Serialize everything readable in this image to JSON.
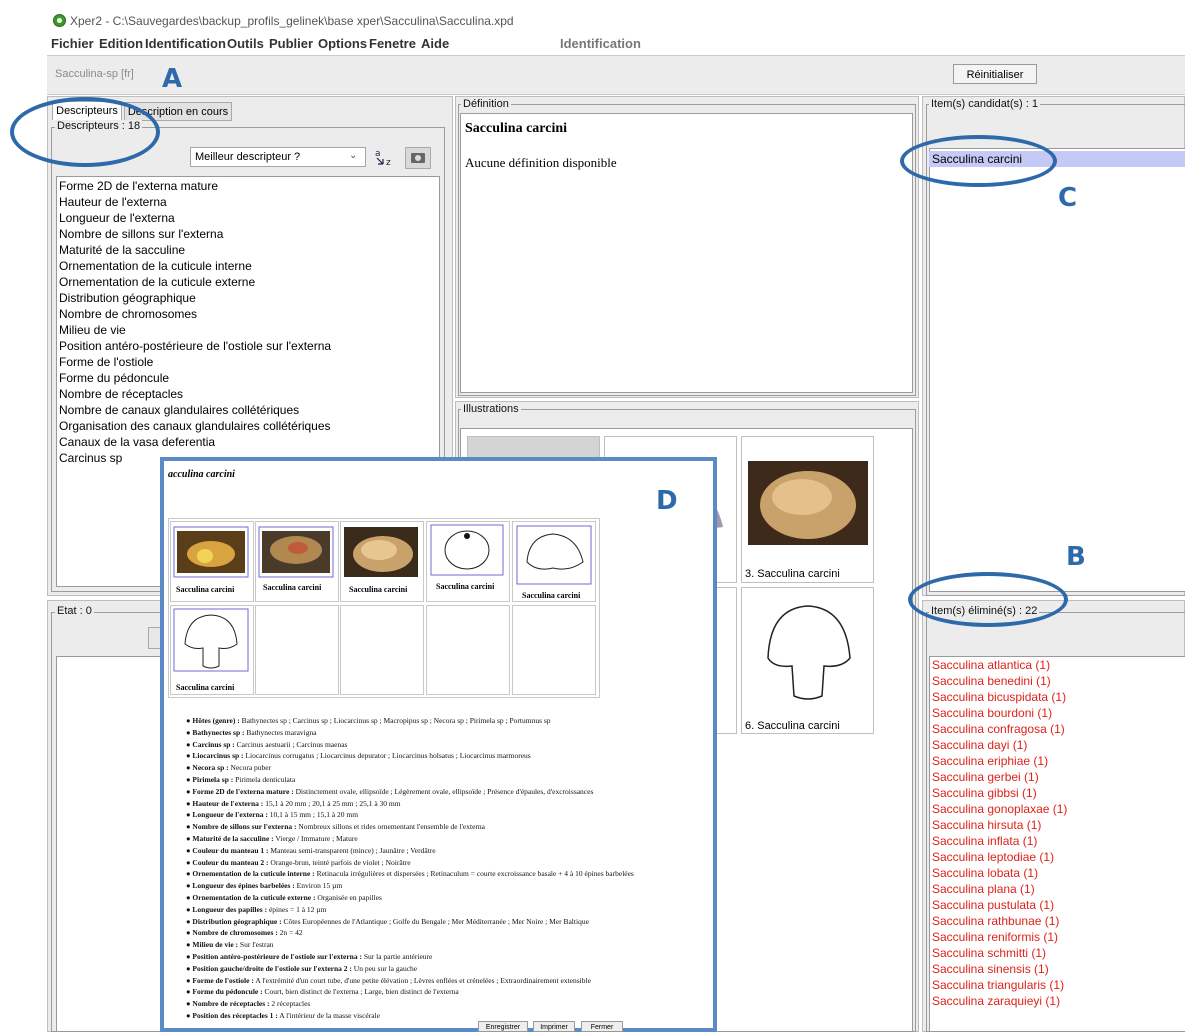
{
  "window": {
    "title": "Xper2 - C:\\Sauvegardes\\backup_profils_gelinek\\base xper\\Sacculina\\Sacculina.xpd"
  },
  "menu": {
    "items": [
      "Fichier",
      "Edition",
      "Identification",
      "Outils",
      "Publier",
      "Options",
      "Fenetre",
      "Aide"
    ],
    "mode": "Identification"
  },
  "toolbar": {
    "item_name": "Sacculina-sp [fr]",
    "reset_label": "Réinitialiser"
  },
  "descriptors_panel": {
    "tabs": [
      "Descripteurs",
      "Description en cours"
    ],
    "legend": "Descripteurs : 18",
    "dropdown_value": "Meilleur descripteur ?",
    "items": [
      "Forme 2D de l'externa mature",
      "Hauteur de l'externa",
      "Longueur de l'externa",
      "Nombre de sillons sur l'externa",
      "Maturité de la sacculine",
      "Ornementation de la cuticule interne",
      "Ornementation de la cuticule externe",
      "Distribution géographique",
      "Nombre de chromosomes",
      "Milieu de vie",
      "Position antéro-postérieure de l'ostiole sur l'externa",
      "Forme de l'ostiole",
      "Forme du pédoncule",
      "Nombre de réceptacles",
      "Nombre de canaux glandulaires collétériques",
      "Organisation des canaux glandulaires collétériques",
      "Canaux de la vasa deferentia",
      "Carcinus sp"
    ]
  },
  "state_panel": {
    "legend": "Etat : 0"
  },
  "definition_panel": {
    "legend": "Définition",
    "title": "Sacculina carcini",
    "text": "Aucune définition disponible"
  },
  "illustrations_panel": {
    "legend": "Illustrations",
    "captions": [
      "3. Sacculina carcini",
      "6. Sacculina carcini"
    ]
  },
  "candidates_panel": {
    "legend": "Item(s) candidat(s) : 1",
    "items": [
      "Sacculina carcini"
    ]
  },
  "eliminated_panel": {
    "legend": "Item(s) éliminé(s) : 22",
    "items": [
      "Sacculina atlantica (1)",
      "Sacculina benedini (1)",
      "Sacculina bicuspidata (1)",
      "Sacculina bourdoni (1)",
      "Sacculina confragosa (1)",
      "Sacculina dayi (1)",
      "Sacculina eriphiae (1)",
      "Sacculina gerbei (1)",
      "Sacculina gibbsi (1)",
      "Sacculina gonoplaxae (1)",
      "Sacculina hirsuta (1)",
      "Sacculina inflata (1)",
      "Sacculina leptodiae (1)",
      "Sacculina lobata (1)",
      "Sacculina plana (1)",
      "Sacculina pustulata (1)",
      "Sacculina rathbunae (1)",
      "Sacculina reniformis (1)",
      "Sacculina schmitti (1)",
      "Sacculina sinensis (1)",
      "Sacculina triangularis (1)",
      "Sacculina zaraquieyi (1)"
    ]
  },
  "annotations": {
    "a": "A",
    "b": "B",
    "c": "C",
    "d": "D"
  },
  "popup": {
    "title": "acculina carcini",
    "thumb_captions": [
      "Sacculina carcini",
      "Sacculina carcini",
      "Sacculina carcini",
      "Sacculina carcini",
      "Sacculina carcini",
      "Sacculina carcini"
    ],
    "facts": [
      {
        "label": "Hôtes (genre) :",
        "value": "Bathynectes sp ; Carcinus sp ; Liocarcinus sp ; Macropipus sp ; Necora sp ; Pirimela sp ; Portumnus sp"
      },
      {
        "label": "Bathynectes sp :",
        "value": "Bathynectes maravigna"
      },
      {
        "label": "Carcinus sp :",
        "value": "Carcinus aestuarii ; Carcinus maenas"
      },
      {
        "label": "Liocarcinus sp :",
        "value": "Liocarcinus corrugatus ; Liocarcinus depurator ; Liocarcinus holsatus ; Liocarcinus marmoreus"
      },
      {
        "label": "Necora sp :",
        "value": "Necora puber"
      },
      {
        "label": "Pirimela sp :",
        "value": "Pirimela denticulata"
      },
      {
        "label": "Forme 2D de l'externa mature :",
        "value": "Distinctement ovale, ellipsoïde ; Légèrement ovale, ellipsoïde ; Présence d'épaules, d'excroissances"
      },
      {
        "label": "Hauteur de l'externa :",
        "value": "15,1 à 20 mm ; 20,1 à 25 mm ; 25,1 à 30 mm"
      },
      {
        "label": "Longueur de l'externa :",
        "value": "10,1 à 15 mm ; 15,1 à 20 mm"
      },
      {
        "label": "Nombre de sillons sur l'externa :",
        "value": "Nombreux sillons et rides ornementant l'ensemble de l'externa"
      },
      {
        "label": "Maturité de la sacculine :",
        "value": "Vierge / Immature ; Mature"
      },
      {
        "label": "Couleur du manteau 1 :",
        "value": "Manteau semi-transparent (mince) ; Jaunâtre ; Verdâtre"
      },
      {
        "label": "Couleur du manteau 2 :",
        "value": "Orange-brun, teinté parfois de violet ; Noirâtre"
      },
      {
        "label": "Ornementation de la cuticule interne :",
        "value": "Retinacula irrégulières et dispersées ; Retinaculum = courte excroissance basale + 4 à 10 épines barbelées"
      },
      {
        "label": "Longueur des épines barbelées :",
        "value": "Environ 15 µm"
      },
      {
        "label": "Ornementation de la cuticule externe :",
        "value": "Organisée en papilles"
      },
      {
        "label": "Longueur des papilles :",
        "value": "épines = 1 à 12 µm"
      },
      {
        "label": "Distribution géographique :",
        "value": "Côtes Européennes de l'Atlantique ; Golfe du Bengale ; Mer Méditerranée ; Mer Noire ; Mer Baltique"
      },
      {
        "label": "Nombre de chromosomes :",
        "value": "2n = 42"
      },
      {
        "label": "Milieu de vie :",
        "value": "Sur l'estran"
      },
      {
        "label": "Position antéro-postérieure de l'ostiole sur l'externa :",
        "value": "Sur la partie antérieure"
      },
      {
        "label": "Position gauche/droite de l'ostiole sur l'externa 2 :",
        "value": "Un peu sur la gauche"
      },
      {
        "label": "Forme de l'ostiole :",
        "value": "A l'extrémité d'un court tube, d'une petite élévation ; Lèvres enflées et crénelées ; Extraordinairement extensible"
      },
      {
        "label": "Forme du pédoncule :",
        "value": "Court, bien distinct de l'externa ; Large, bien distinct de l'externa"
      },
      {
        "label": "Nombre de réceptacles :",
        "value": "2 réceptacles"
      },
      {
        "label": "Position des réceptacles 1 :",
        "value": "A l'intérieur de la masse viscérale"
      }
    ],
    "buttons": [
      "Enregistrer",
      "Imprimer",
      "Fermer"
    ]
  },
  "colors": {
    "accent": "#2e6aa9",
    "eliminated": "#e0221a",
    "selection": "#c5c9f5"
  }
}
